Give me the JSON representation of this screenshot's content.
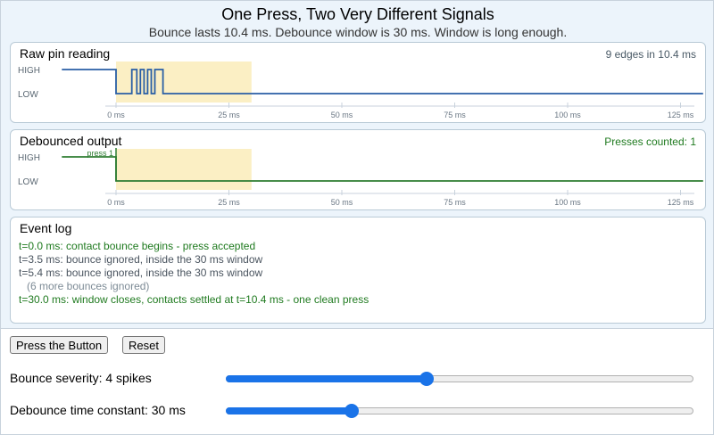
{
  "header": {
    "title": "One Press, Two Very Different Signals",
    "subtitle": "Bounce lasts 10.4 ms. Debounce window is 30 ms.  Window is long enough."
  },
  "raw_panel": {
    "title": "Raw pin reading",
    "note": "9 edges in 10.4 ms",
    "high_label": "HIGH",
    "low_label": "LOW",
    "ticks": [
      "0 ms",
      "25 ms",
      "50 ms",
      "75 ms",
      "100 ms",
      "125 ms"
    ]
  },
  "debounced_panel": {
    "title": "Debounced output",
    "note": "Presses counted: 1",
    "high_label": "HIGH",
    "low_label": "LOW",
    "press_label": "press 1",
    "ticks": [
      "0 ms",
      "25 ms",
      "50 ms",
      "75 ms",
      "100 ms",
      "125 ms"
    ]
  },
  "event_log": {
    "title": "Event log",
    "lines": [
      "t=0.0 ms: contact bounce begins - press accepted",
      "t=3.5 ms: bounce ignored, inside the 30 ms window",
      "t=5.4 ms: bounce ignored, inside the 30 ms window",
      "(6 more bounces ignored)",
      "t=30.0 ms: window closes, contacts settled at t=10.4 ms - one clean press"
    ]
  },
  "controls": {
    "press_button": "Press the Button",
    "reset_button": "Reset",
    "bounce_label": "Bounce severity: 4 spikes",
    "bounce_fraction": 0.43,
    "debounce_label": "Debounce time constant: 30 ms",
    "debounce_fraction": 0.27
  },
  "chart_data": {
    "type": "line",
    "time_unit": "ms",
    "xlim": [
      -12,
      130
    ],
    "xticks": [
      0,
      25,
      50,
      75,
      100,
      125
    ],
    "debounce_window": [
      0,
      30
    ],
    "raw": {
      "edges": [
        [
          -12,
          1
        ],
        [
          0,
          1
        ],
        [
          0,
          0
        ],
        [
          3.5,
          0
        ],
        [
          3.5,
          1
        ],
        [
          4.6,
          1
        ],
        [
          4.6,
          0
        ],
        [
          5.4,
          0
        ],
        [
          5.4,
          1
        ],
        [
          6.2,
          1
        ],
        [
          6.2,
          0
        ],
        [
          7.0,
          0
        ],
        [
          7.0,
          1
        ],
        [
          7.8,
          1
        ],
        [
          7.8,
          0
        ],
        [
          8.6,
          0
        ],
        [
          8.6,
          1
        ],
        [
          10.4,
          1
        ],
        [
          10.4,
          0
        ],
        [
          130,
          0
        ]
      ]
    },
    "debounced": {
      "edges": [
        [
          -12,
          1
        ],
        [
          0,
          1
        ],
        [
          0,
          0
        ],
        [
          130,
          0
        ]
      ],
      "press_times": [
        0
      ]
    },
    "colors": {
      "raw_line": "#2a5fa5",
      "debounced_line": "#2e7d32",
      "window_fill": "#fbefc4",
      "tick_line": "#c8d2dc",
      "axis_text": "#6a7784"
    }
  }
}
